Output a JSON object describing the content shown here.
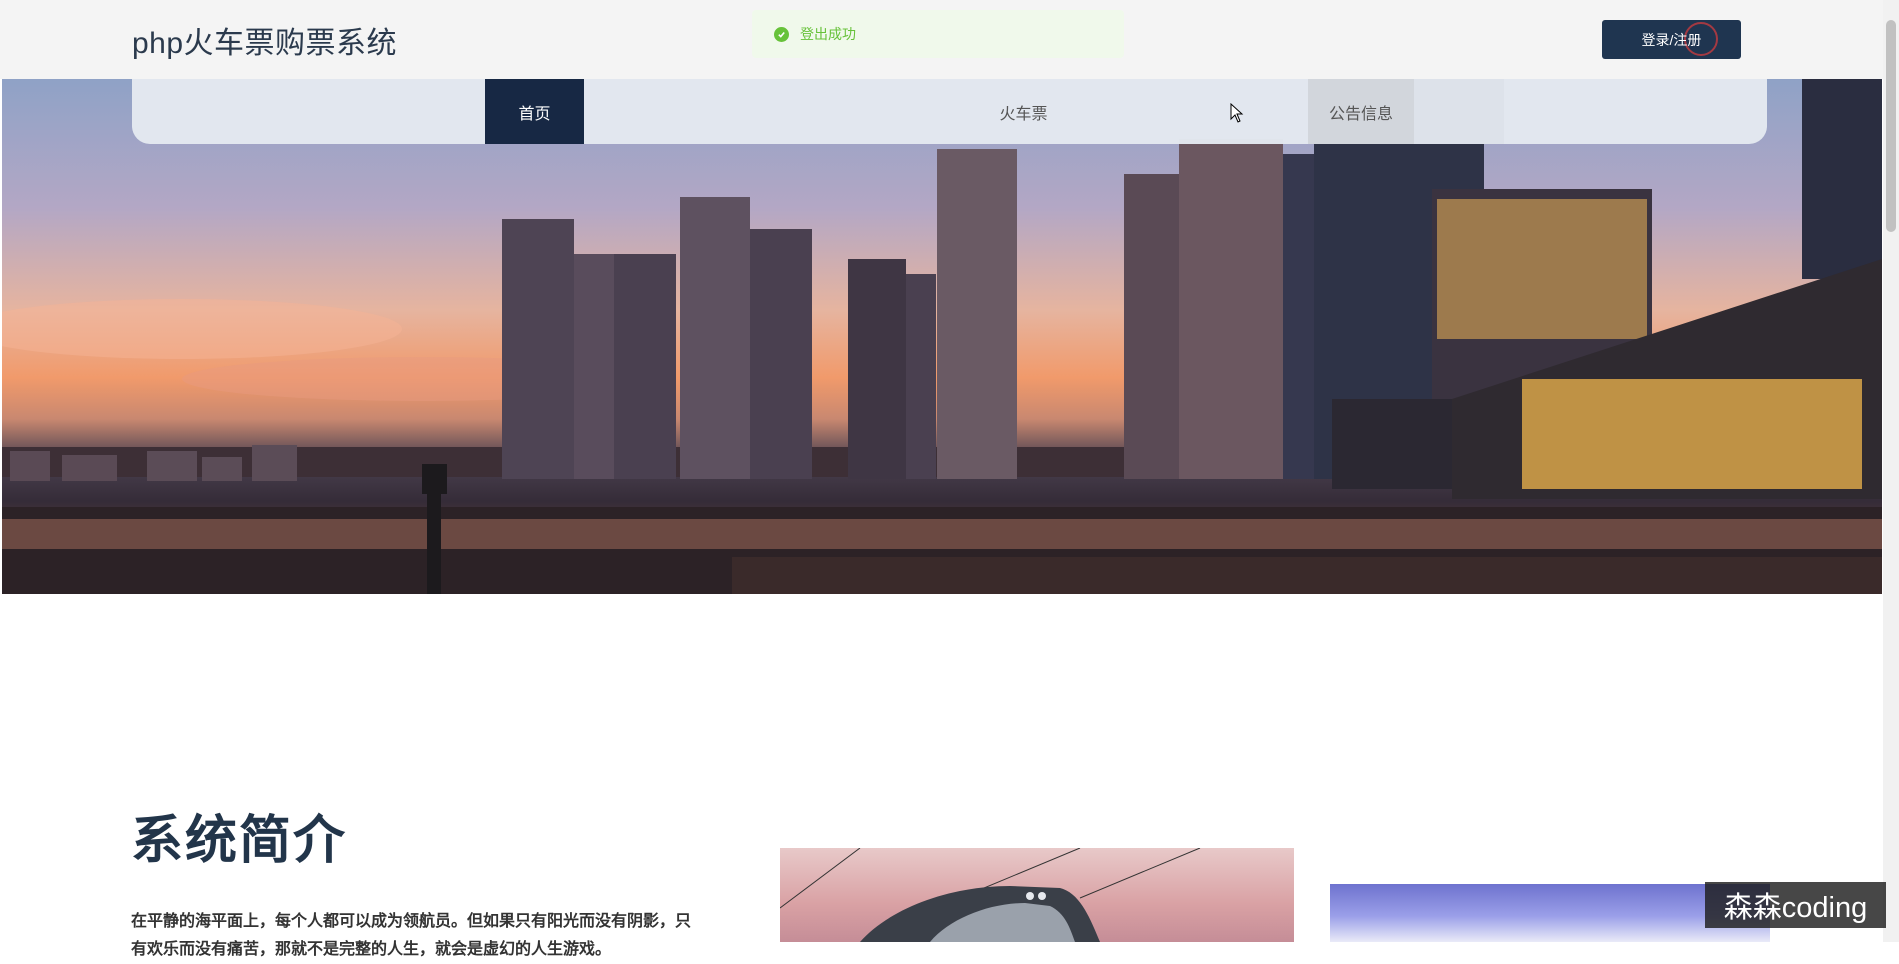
{
  "header": {
    "brand": "php火车票购票系统",
    "login_label": "登录/注册"
  },
  "toast": {
    "message": "登出成功",
    "icon": "check-circle-icon"
  },
  "nav": {
    "items": [
      {
        "label": "首页",
        "active": true
      },
      {
        "label": "火车票",
        "active": false
      },
      {
        "label": "公告信息",
        "active": false
      }
    ]
  },
  "intro": {
    "title": "系统简介",
    "text": "在平静的海平面上，每个人都可以成为领航员。但如果只有阳光而没有阴影，只有欢乐而没有痛苦，那就不是完整的人生，就会是虚幻的人生游戏。"
  },
  "watermark": "森森coding",
  "colors": {
    "primary": "#1f3550",
    "nav_active": "#172844",
    "toast_bg": "#f0f9eb",
    "toast_text": "#67c23a",
    "title_text": "#22354a"
  }
}
